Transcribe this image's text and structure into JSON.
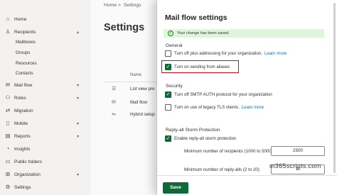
{
  "nav": {
    "items": [
      {
        "icon": "home-icon",
        "glyph": "⌂",
        "label": "Home"
      },
      {
        "icon": "person-icon",
        "glyph": "♙",
        "label": "Recipients",
        "expanded": true
      },
      {
        "icon": "mail-icon",
        "glyph": "✉",
        "label": "Mail flow"
      },
      {
        "icon": "roles-icon",
        "glyph": "⚇",
        "label": "Roles"
      },
      {
        "icon": "migration-icon",
        "glyph": "⇄",
        "label": "Migration"
      },
      {
        "icon": "mobile-icon",
        "glyph": "▯",
        "label": "Mobile"
      },
      {
        "icon": "reports-icon",
        "glyph": "▤",
        "label": "Reports"
      },
      {
        "icon": "insights-icon",
        "glyph": "◔",
        "label": "Insights"
      },
      {
        "icon": "folder-icon",
        "glyph": "▭",
        "label": "Public folders"
      },
      {
        "icon": "organization-icon",
        "glyph": "⊞",
        "label": "Organization"
      },
      {
        "icon": "gear-icon",
        "glyph": "⚙",
        "label": "Settings"
      }
    ],
    "sub_items": [
      "Mailboxes",
      "Groups",
      "Resources",
      "Contacts"
    ]
  },
  "main": {
    "breadcrumb_home": "Home",
    "breadcrumb_sep": ">",
    "breadcrumb_current": "Settings",
    "title": "Settings",
    "column_header": "Name",
    "rows": [
      "List view pre",
      "Mail flow",
      "Hybrid setup"
    ]
  },
  "panel": {
    "title": "Mail flow settings",
    "success_message": "Your change has been saved.",
    "general_heading": "General",
    "opt_plus_addressing": "Turn off plus addressing for your organization.",
    "opt_plus_addressing_link": "Learn more",
    "opt_sending_aliases": "Turn on sending from aliases",
    "security_heading": "Security",
    "opt_smtp_auth": "Turn off SMTP AUTH protocol for your organization",
    "opt_legacy_tls": "Turn on use of legacy TLS clients.",
    "opt_legacy_tls_link": "Learn more",
    "reply_all_heading": "Reply-all Storm Protection",
    "opt_reply_all": "Enable reply-all storm protection",
    "min_recipients_label": "Minimum number of recipients (1000 to 5000)",
    "min_recipients_value": "2500",
    "min_reply_alls_label": "Minimum number of reply-alls (2 to 20)",
    "min_reply_alls_value": "10",
    "save_label": "Save",
    "checkbox_states": {
      "plus_addressing": false,
      "sending_aliases": true,
      "smtp_auth": true,
      "legacy_tls": false,
      "reply_all": true
    }
  },
  "watermark": "m365scripts.com",
  "colors": {
    "accent": "#0f6a39",
    "success_bg": "#dff6dd",
    "highlight_border": "#c50f1f",
    "link": "#0f6cbd"
  }
}
